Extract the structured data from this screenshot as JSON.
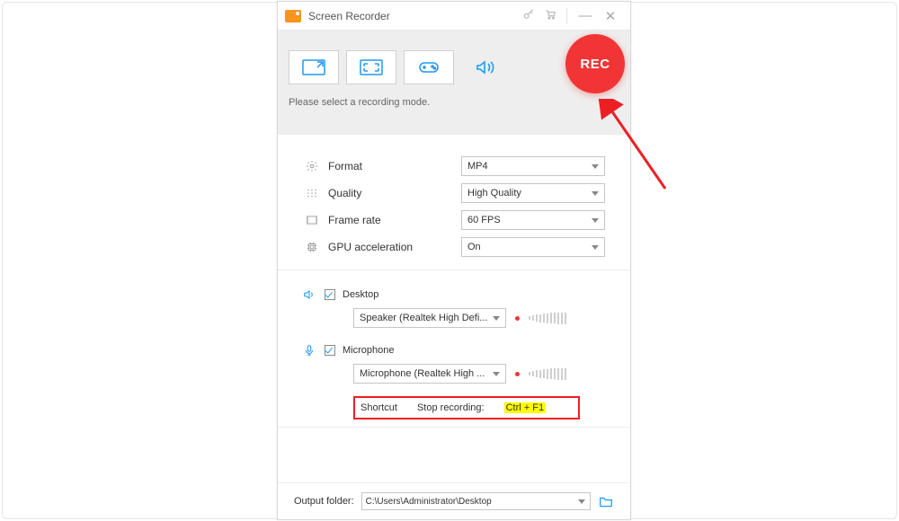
{
  "title_bar": {
    "app_title": "Screen Recorder"
  },
  "mode": {
    "hint": "Please select a recording mode.",
    "rec_label": "REC"
  },
  "settings": {
    "format_label": "Format",
    "format_value": "MP4",
    "quality_label": "Quality",
    "quality_value": "High Quality",
    "fps_label": "Frame rate",
    "fps_value": "60 FPS",
    "gpu_label": "GPU acceleration",
    "gpu_value": "On"
  },
  "audio": {
    "desktop_label": "Desktop",
    "desktop_device": "Speaker (Realtek High Defi...",
    "mic_label": "Microphone",
    "mic_device": "Microphone (Realtek High ..."
  },
  "shortcut": {
    "label": "Shortcut",
    "action_label": "Stop recording:",
    "keys": "Ctrl + F1"
  },
  "footer": {
    "output_label": "Output folder:",
    "output_path": "C:\\Users\\Administrator\\Desktop"
  }
}
